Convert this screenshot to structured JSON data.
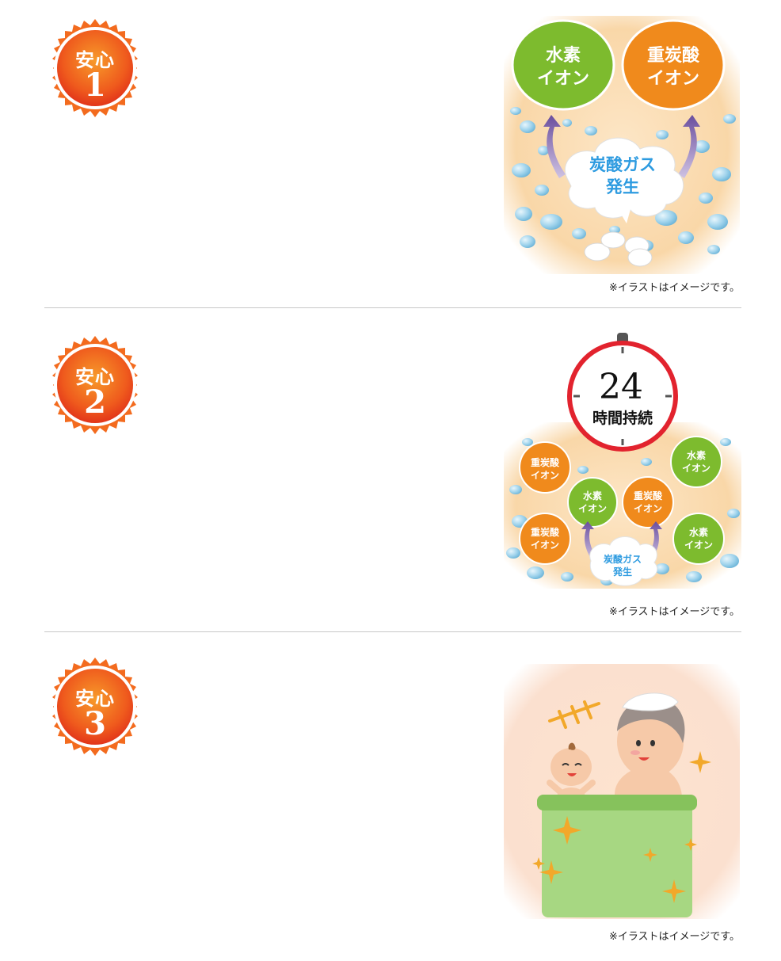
{
  "sections": [
    {
      "badge": {
        "label": "安心",
        "number": "1"
      },
      "illustration": {
        "left_bubble": [
          "水素",
          "イオン"
        ],
        "right_bubble": [
          "重炭酸",
          "イオン"
        ],
        "cloud": [
          "炭酸ガス",
          "発生"
        ]
      },
      "caption": "※イラストはイメージです。"
    },
    {
      "badge": {
        "label": "安心",
        "number": "2"
      },
      "illustration": {
        "timer_number": "24",
        "timer_label": "時間持続",
        "bubbles": {
          "bicarbonate": [
            "重炭酸",
            "イオン"
          ],
          "hydrogen": [
            "水素",
            "イオン"
          ]
        },
        "cloud": [
          "炭酸ガス",
          "発生"
        ]
      },
      "caption": "※イラストはイメージです。"
    },
    {
      "badge": {
        "label": "安心",
        "number": "3"
      },
      "illustration": {},
      "caption": "※イラストはイメージです。"
    }
  ],
  "colors": {
    "badge_orange": "#f47a20",
    "badge_red": "#e8401a",
    "hydrogen_green": "#7dbb2e",
    "bicarbonate_orange": "#f08a1c",
    "cloud_text_blue": "#2d9be0",
    "arrow_purple": "#7a5ea8",
    "timer_red": "#e2232e",
    "tub_green": "#9fd07a"
  }
}
